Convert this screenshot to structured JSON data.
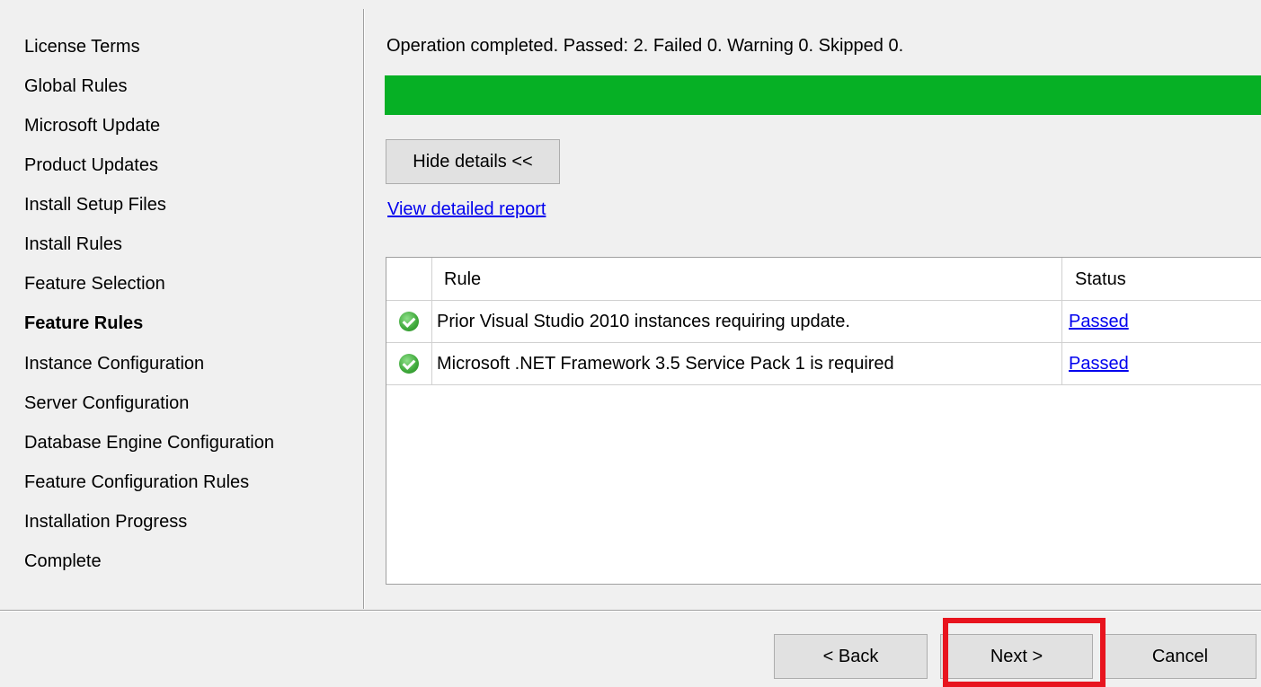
{
  "sidebar": {
    "items": [
      {
        "label": "License Terms"
      },
      {
        "label": "Global Rules"
      },
      {
        "label": "Microsoft Update"
      },
      {
        "label": "Product Updates"
      },
      {
        "label": "Install Setup Files"
      },
      {
        "label": "Install Rules"
      },
      {
        "label": "Feature Selection"
      },
      {
        "label": "Feature Rules"
      },
      {
        "label": "Instance Configuration"
      },
      {
        "label": "Server Configuration"
      },
      {
        "label": "Database Engine Configuration"
      },
      {
        "label": "Feature Configuration Rules"
      },
      {
        "label": "Installation Progress"
      },
      {
        "label": "Complete"
      }
    ],
    "current_item": "Feature Rules"
  },
  "main": {
    "status_text": "Operation completed. Passed: 2.   Failed 0.   Warning 0.   Skipped 0.",
    "progress_fraction": 1.0,
    "progress_color": "#06b025",
    "hide_details_label": "Hide details <<",
    "view_report_label": "View detailed report",
    "grid": {
      "columns": [
        "",
        "Rule",
        "Status"
      ],
      "rows": [
        {
          "icon": "check-circle-icon",
          "rule": "Prior Visual Studio 2010 instances requiring update.",
          "status": "Passed"
        },
        {
          "icon": "check-circle-icon",
          "rule": "Microsoft .NET Framework 3.5 Service Pack 1 is required",
          "status": "Passed"
        }
      ]
    }
  },
  "footer": {
    "back_label": "< Back",
    "next_label": "Next >",
    "cancel_label": "Cancel",
    "highlight_color": "#e8141e"
  }
}
